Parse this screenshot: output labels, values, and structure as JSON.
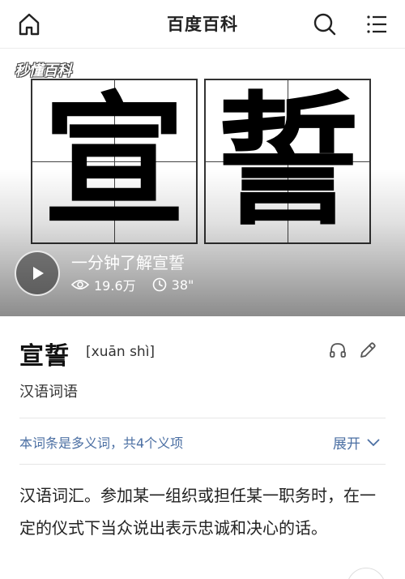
{
  "header": {
    "title": "百度百科",
    "icons": [
      "home-icon",
      "search-icon",
      "menu-icon"
    ]
  },
  "media": {
    "watermark": "秒懂百科",
    "characters": [
      "宣",
      "誓"
    ],
    "video_title": "一分钟了解宣誓",
    "views": "19.6万",
    "duration": "38\""
  },
  "term": {
    "title": "宣誓",
    "pinyin": "[xuān shì]",
    "category": "汉语词语"
  },
  "polysemy": {
    "notice": "本词条是多义词，共4个义项",
    "expand_label": "展开"
  },
  "definition": "汉语词汇。参加某一组织或担任某一职务时，在一定的仪式下当众说出表示忠诚和决心的话。",
  "colors": {
    "link": "#4b6fa3",
    "text": "#222222"
  }
}
